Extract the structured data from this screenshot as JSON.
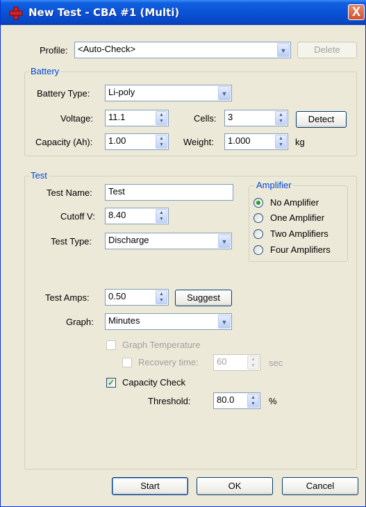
{
  "window": {
    "title": "New Test - CBA #1 (Multi)",
    "close_glyph": "X",
    "colors": {
      "titlebar": "#0a52d6",
      "dialog_bg": "#ece9d8",
      "group_title": "#0046d5"
    }
  },
  "profile": {
    "label": "Profile:",
    "value": "<Auto-Check>",
    "delete_label": "Delete"
  },
  "battery": {
    "group_title": "Battery",
    "type_label": "Battery Type:",
    "type_value": "Li-poly",
    "voltage_label": "Voltage:",
    "voltage_value": "11.1",
    "cells_label": "Cells:",
    "cells_value": "3",
    "detect_label": "Detect",
    "capacity_label": "Capacity (Ah):",
    "capacity_value": "1.00",
    "weight_label": "Weight:",
    "weight_value": "1.000",
    "weight_unit": "kg"
  },
  "test": {
    "group_title": "Test",
    "name_label": "Test Name:",
    "name_value": "Test",
    "cutoff_label": "Cutoff V:",
    "cutoff_value": "8.40",
    "type_label": "Test Type:",
    "type_value": "Discharge",
    "amps_label": "Test Amps:",
    "amps_value": "0.50",
    "suggest_label": "Suggest",
    "graph_label": "Graph:",
    "graph_value": "Minutes",
    "graph_temperature_label": "Graph Temperature",
    "recovery_label": "Recovery time:",
    "recovery_value": "60",
    "recovery_unit": "sec",
    "capacity_check_label": "Capacity Check",
    "capacity_check_checked": true,
    "threshold_label": "Threshold:",
    "threshold_value": "80.0",
    "threshold_unit": "%"
  },
  "amplifier": {
    "group_title": "Amplifier",
    "options": [
      "No Amplifier",
      "One Amplifier",
      "Two Amplifiers",
      "Four Amplifiers"
    ],
    "selected": "No Amplifier"
  },
  "footer": {
    "start_label": "Start",
    "ok_label": "OK",
    "cancel_label": "Cancel"
  }
}
